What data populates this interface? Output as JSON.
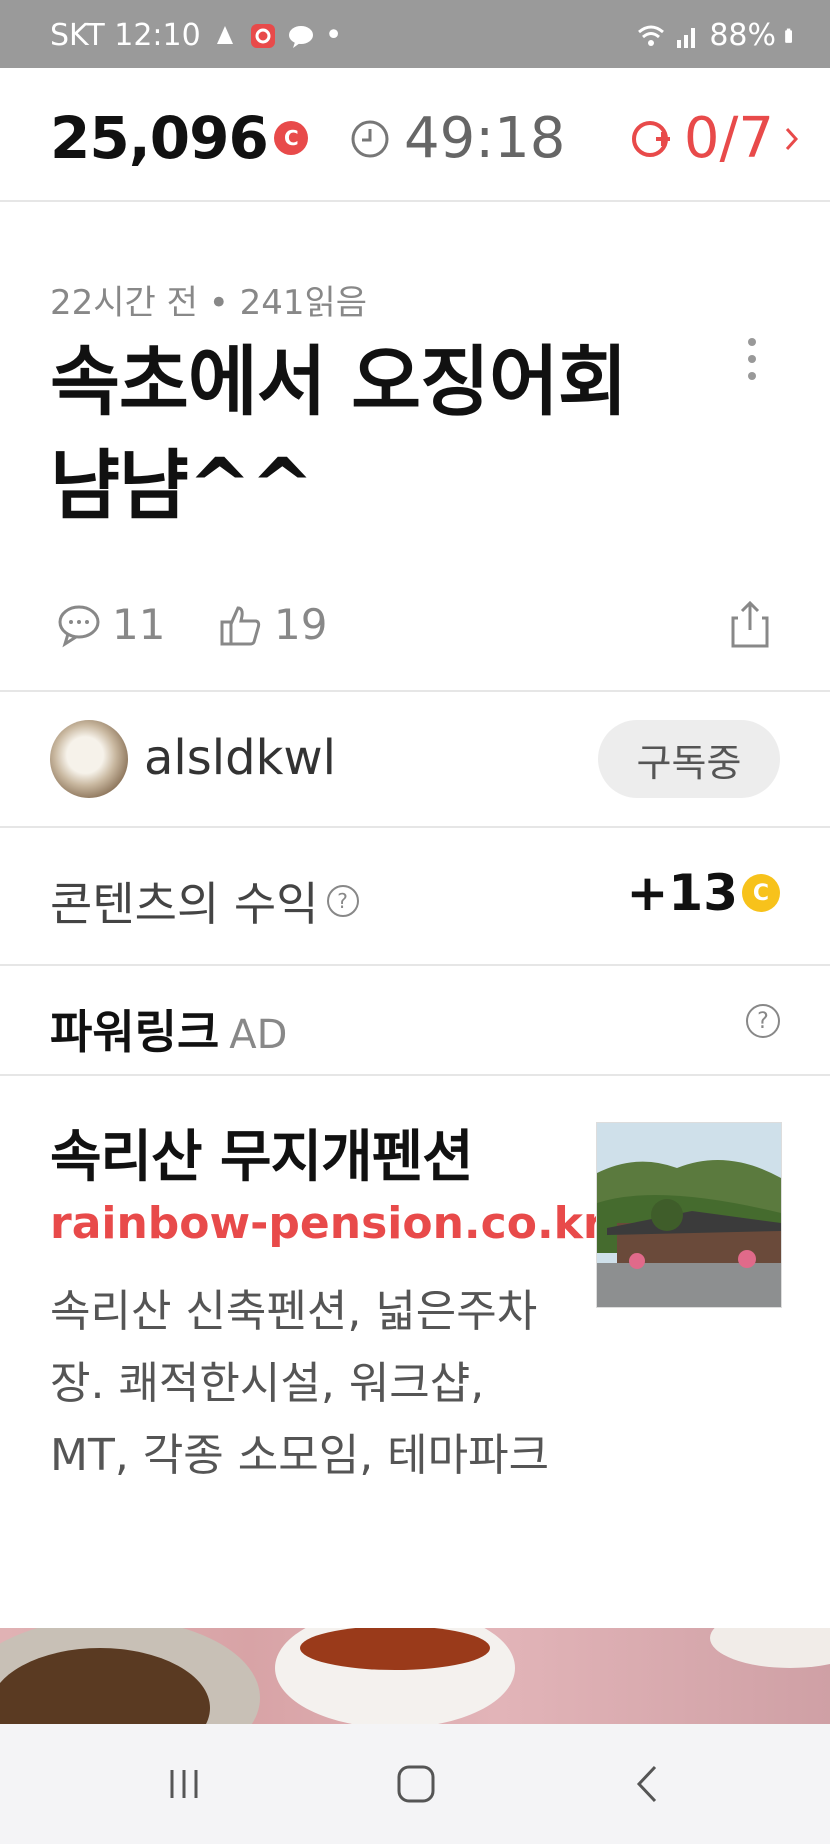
{
  "status_bar": {
    "carrier_time": "SKT 12:10",
    "battery": "88%"
  },
  "top_bar": {
    "points": "25,096",
    "coin_letter": "C",
    "timer": "49:18",
    "mission": "0/7",
    "accent_color": "#e84a4a"
  },
  "post": {
    "meta": "22시간 전 • 241읽음",
    "title": "속초에서 오징어회 냠냠^^",
    "comments": "11",
    "likes": "19"
  },
  "author": {
    "name": "alsldkwl",
    "subscribe_label": "구독중"
  },
  "revenue": {
    "label": "콘텐츠의 수익",
    "value": "+13",
    "coin_letter": "C"
  },
  "powerlink": {
    "title": "파워링크",
    "ad_label": "AD"
  },
  "ad": {
    "title": "속리산 무지개펜션",
    "url": "rainbow-pension.co.kr",
    "description": "속리산 신축펜션, 넓은주차장. 쾌적한시설, 워크샵, MT, 각종 소모임, 테마파크"
  },
  "icons": {
    "status": [
      "notification-icon",
      "q-app-icon",
      "chat-bubble-icon",
      "wifi-icon",
      "signal-icon",
      "battery-icon"
    ],
    "top": [
      "coin-icon",
      "clock-icon",
      "coin-plus-icon",
      "chevron-right-icon"
    ],
    "actions": [
      "comment-icon",
      "thumbs-up-icon",
      "share-icon"
    ],
    "nav": [
      "recent-apps-icon",
      "home-icon",
      "back-icon"
    ]
  }
}
